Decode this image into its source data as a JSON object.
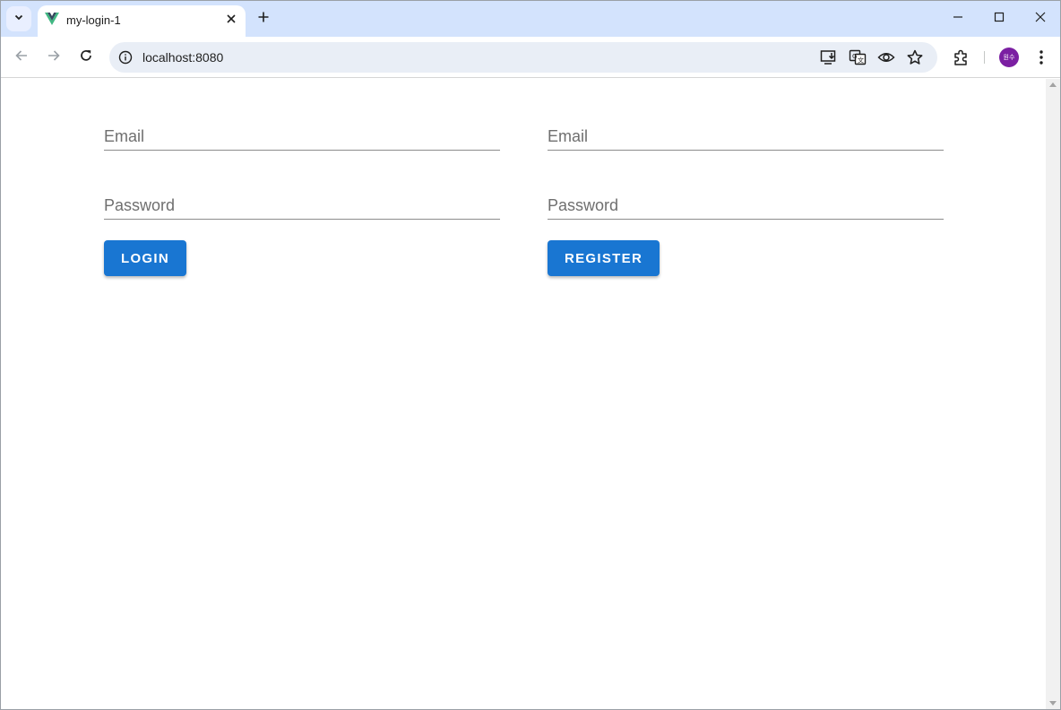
{
  "browser": {
    "tab_title": "my-login-1",
    "url": "localhost:8080",
    "avatar_initials": "원수",
    "accent_color": "#d3e3fd",
    "avatar_color": "#7b1fa2"
  },
  "login_form": {
    "email_placeholder": "Email",
    "password_placeholder": "Password",
    "button_label": "LOGIN"
  },
  "register_form": {
    "email_placeholder": "Email",
    "password_placeholder": "Password",
    "button_label": "REGISTER"
  },
  "colors": {
    "primary_button": "#1976d2"
  }
}
